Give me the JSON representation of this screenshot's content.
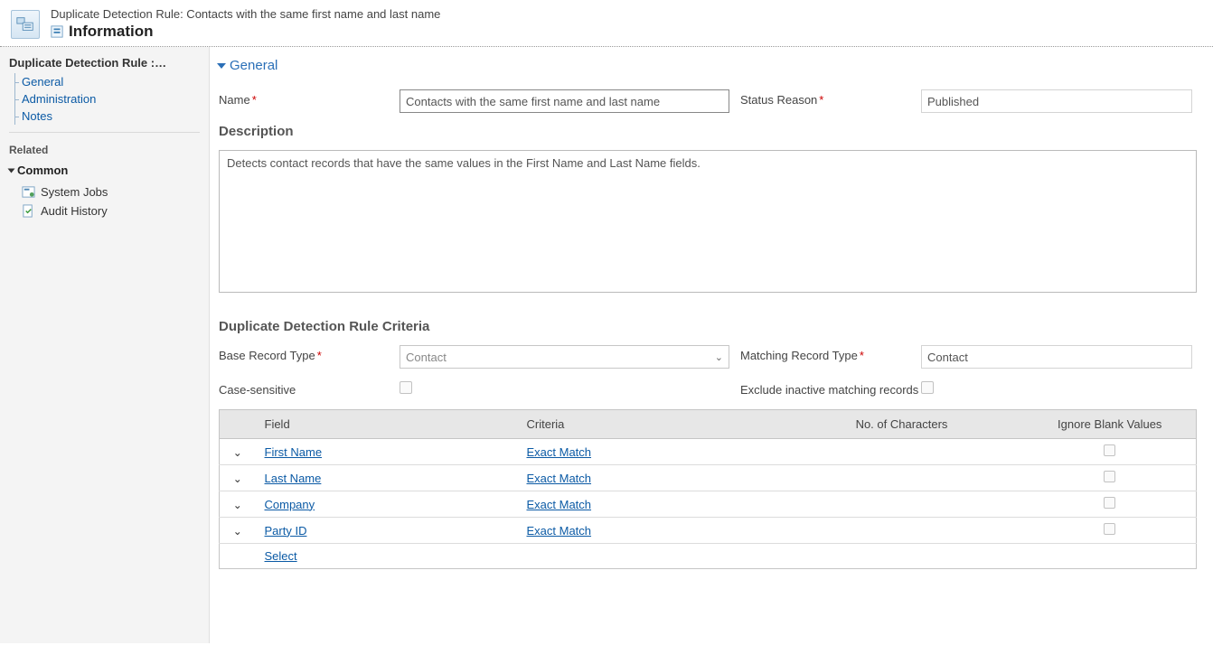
{
  "header": {
    "breadcrumb": "Duplicate Detection Rule: Contacts with the same first name and last name",
    "title": "Information"
  },
  "sidebar": {
    "heading": "Duplicate Detection Rule :…",
    "tree": [
      "General",
      "Administration",
      "Notes"
    ],
    "related": "Related",
    "group": "Common",
    "common": [
      "System Jobs",
      "Audit History"
    ]
  },
  "general": {
    "section": "General",
    "name_label": "Name",
    "name_value": "Contacts with the same first name and last name",
    "status_label": "Status Reason",
    "status_value": "Published",
    "description_label": "Description",
    "description_value": "Detects contact records that have the same values in the First Name and Last Name fields.",
    "criteria_heading": "Duplicate Detection Rule Criteria",
    "base_label": "Base Record Type",
    "base_value": "Contact",
    "matching_label": "Matching Record Type",
    "matching_value": "Contact",
    "case_label": "Case-sensitive",
    "exclude_label": "Exclude inactive matching records"
  },
  "table": {
    "headers": {
      "field": "Field",
      "criteria": "Criteria",
      "chars": "No. of Characters",
      "ignore": "Ignore Blank Values"
    },
    "rows": [
      {
        "field": "First Name",
        "criteria": "Exact Match"
      },
      {
        "field": "Last Name",
        "criteria": "Exact Match"
      },
      {
        "field": "Company",
        "criteria": "Exact Match"
      },
      {
        "field": "Party ID",
        "criteria": "Exact Match"
      }
    ],
    "select_row": "Select"
  }
}
